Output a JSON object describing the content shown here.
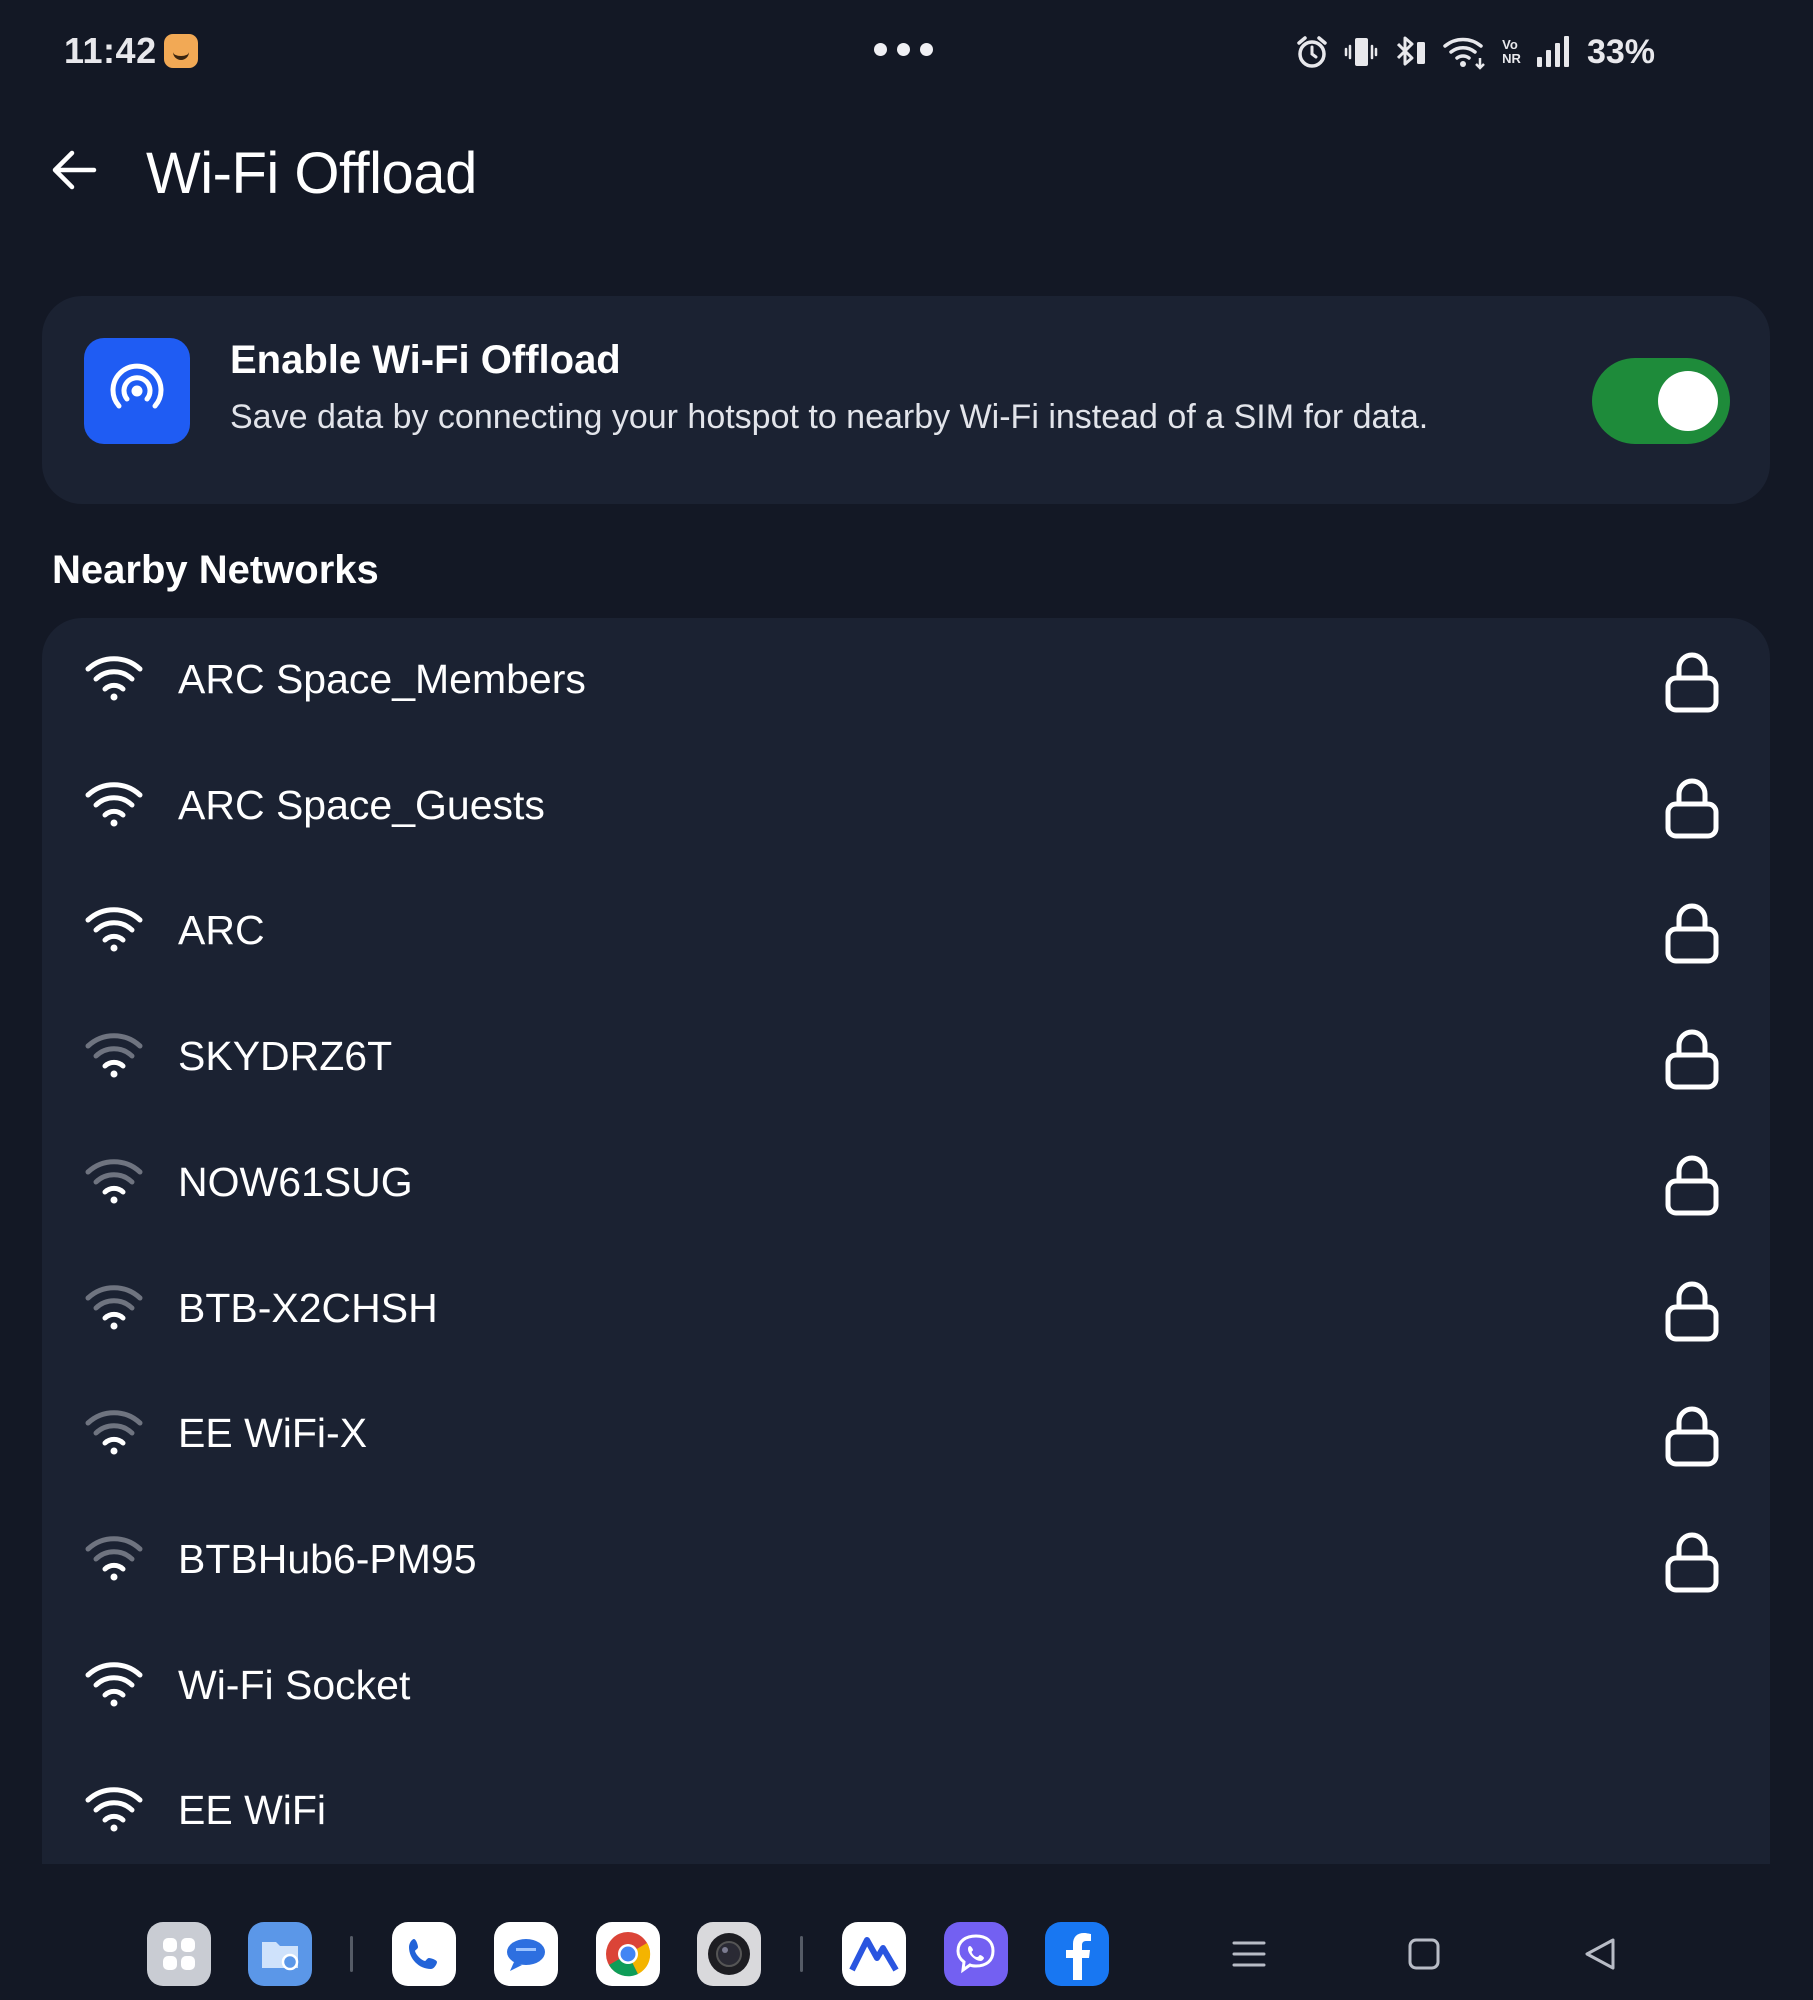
{
  "status_bar": {
    "time": "11:42",
    "battery": "33%",
    "network_badge_top": "Vo",
    "network_badge_bottom": "NR"
  },
  "header": {
    "title": "Wi-Fi Offload",
    "back_icon": "arrow-left-icon"
  },
  "enable_card": {
    "title": "Enable Wi-Fi Offload",
    "description": "Save data by connecting your hotspot to nearby Wi-Fi instead of a SIM for data.",
    "toggle_on": true,
    "accent_color": "#1f5cf3",
    "toggle_color": "#1e8b3a"
  },
  "nearby": {
    "heading": "Nearby Networks",
    "networks": [
      {
        "name": "ARC Space_Members",
        "strength": "strong",
        "locked": true
      },
      {
        "name": "ARC Space_Guests",
        "strength": "strong",
        "locked": true
      },
      {
        "name": "ARC",
        "strength": "strong",
        "locked": true
      },
      {
        "name": "SKYDRZ6T",
        "strength": "weak",
        "locked": true
      },
      {
        "name": "NOW61SUG",
        "strength": "weak",
        "locked": true
      },
      {
        "name": "BTB-X2CHSH",
        "strength": "weak",
        "locked": true
      },
      {
        "name": "EE WiFi-X",
        "strength": "weak",
        "locked": true
      },
      {
        "name": "BTBHub6-PM95",
        "strength": "weak",
        "locked": true
      },
      {
        "name": "Wi-Fi Socket",
        "strength": "strong",
        "locked": false
      },
      {
        "name": "EE WiFi",
        "strength": "strong",
        "locked": false
      }
    ]
  },
  "dock": {
    "apps": [
      "app-drawer-icon",
      "files-icon",
      "phone-icon",
      "messages-icon",
      "chrome-icon",
      "camera-icon",
      "nord-icon",
      "viber-icon",
      "facebook-icon"
    ],
    "nav": [
      "recents-icon",
      "home-icon",
      "back-icon"
    ]
  }
}
